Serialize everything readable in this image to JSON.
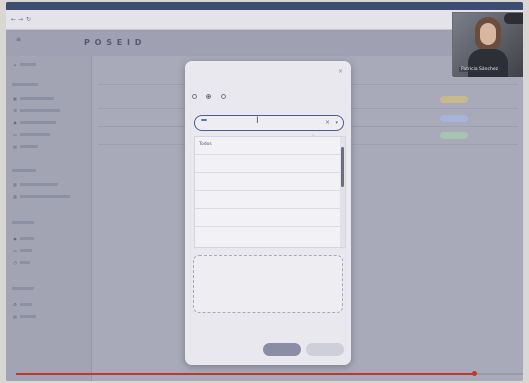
{
  "window": {
    "title": ""
  },
  "browser": {
    "url": ""
  },
  "app": {
    "logo": "P O S E I D"
  },
  "sidebar": {
    "items": [
      {
        "icon": "home-icon",
        "label": ""
      },
      {
        "icon": "grid-icon",
        "label": ""
      },
      {
        "icon": "list-icon",
        "label": ""
      },
      {
        "icon": "user-icon",
        "label": ""
      },
      {
        "icon": "folder-icon",
        "label": ""
      },
      {
        "icon": "doc-icon",
        "label": ""
      },
      {
        "icon": "chart-icon",
        "label": ""
      },
      {
        "icon": "settings-icon",
        "label": ""
      }
    ]
  },
  "main": {
    "breadcrumb": "",
    "pager": ""
  },
  "modal": {
    "title": "",
    "select_label": "",
    "radio_options": [
      "",
      "",
      ""
    ],
    "radio_selected_index": 1,
    "field_label": "",
    "search_value": "",
    "options": [
      "Todos",
      "",
      "",
      "",
      "",
      ""
    ],
    "dropzone_line1": "",
    "dropzone_line2": "",
    "dropzone_link": "",
    "cancel_label": "",
    "save_label": ""
  },
  "video": {
    "participant_name": "Patricia Sánchez",
    "logo": ""
  },
  "playback": {
    "progress_fraction": 0.9
  },
  "colors": {
    "accent": "#4e5c93",
    "selection": "#5b73c4",
    "progress": "#c0392b"
  }
}
